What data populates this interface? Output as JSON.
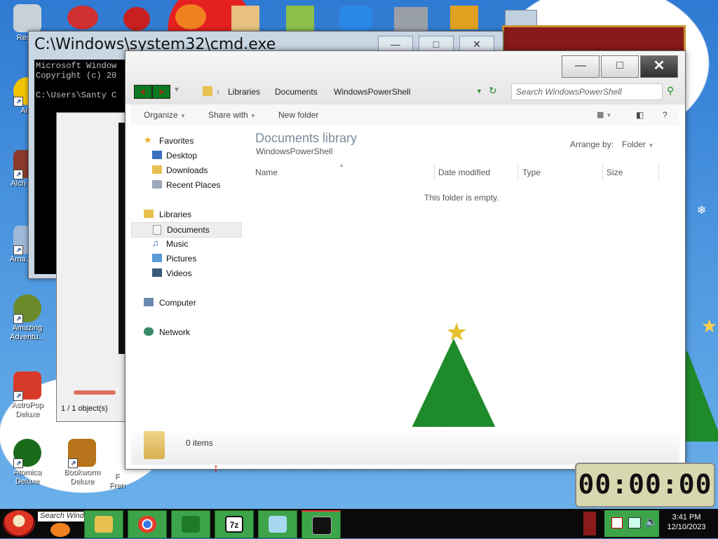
{
  "desktop": {
    "icons": [
      {
        "label": "Recycle Bin",
        "short": "Recyc"
      },
      {
        "label": "AIM",
        "short": "AIM"
      },
      {
        "label": "Alchemy Deluxe",
        "short": "Alch Delu"
      },
      {
        "label": "Amazing Adventures",
        "short": "Ama Adve"
      },
      {
        "label": "Amazing Adventu...",
        "short": "Amazing Adventu..."
      },
      {
        "label": "AstroPop Deluxe",
        "short": "AstroPop Deluxe"
      },
      {
        "label": "Atomica Deluxe",
        "short": "Atomica Deluxe"
      },
      {
        "label": "Bookworm Deluxe",
        "short": "Bookworm Deluxe"
      },
      {
        "label": "Frenzy",
        "short": "F Fren"
      }
    ]
  },
  "cmd": {
    "title": "C:\\Windows\\system32\\cmd.exe",
    "lines": "Microsoft Window\nCopyright (c) 20\n\nC:\\Users\\Santy C",
    "min_label": "—",
    "max_label": "□",
    "close_label": "✕"
  },
  "win2": {
    "status": "1 / 1 object(s)"
  },
  "explorer": {
    "min_label": "—",
    "max_label": "□",
    "close_label": "✕",
    "back_label": "<",
    "forward_label": ">",
    "breadcrumb": [
      "Libraries",
      "Documents",
      "WindowsPowerShell"
    ],
    "search_placeholder": "Search WindowsPowerShell",
    "toolbar": {
      "organize": "Organize",
      "share_with": "Share with",
      "new_folder": "New folder",
      "help": "?"
    },
    "nav": {
      "favorites": "Favorites",
      "desktop": "Desktop",
      "downloads": "Downloads",
      "recent_places": "Recent Places",
      "libraries": "Libraries",
      "documents": "Documents",
      "music": "Music",
      "pictures": "Pictures",
      "videos": "Videos",
      "computer": "Computer",
      "network": "Network"
    },
    "library_title": "Documents library",
    "library_sub": "WindowsPowerShell",
    "arrange_by_label": "Arrange by:",
    "arrange_by_value": "Folder",
    "columns": [
      "Name",
      "Date modified",
      "Type",
      "Size"
    ],
    "empty_text": "This folder is empty.",
    "items_count": "0 items"
  },
  "timer": {
    "value": "00:00:00"
  },
  "taskbar": {
    "search_text": "Search Wind",
    "time": "3:41 PM",
    "date": "12/10/2023",
    "apps": [
      "Firefox",
      "File Explorer",
      "Chrome",
      "Christmas Tree",
      "7-Zip",
      "Notepad",
      "Command Prompt"
    ]
  },
  "colors": {
    "taskbar_green": "#3da44a",
    "desktop_blue": "#3f86d6",
    "close_dark": "#2e2e2e"
  }
}
